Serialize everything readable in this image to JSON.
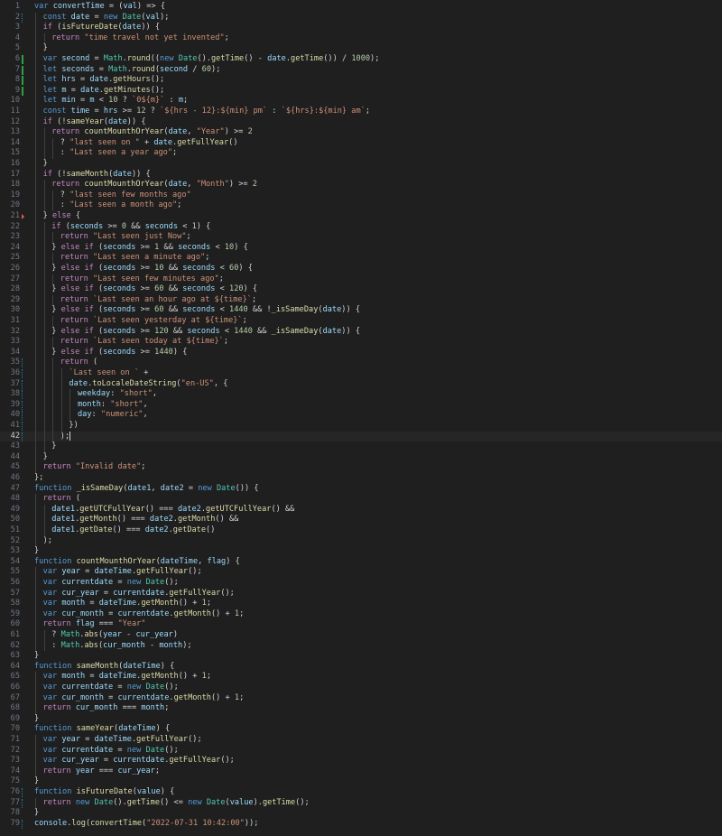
{
  "editor": {
    "active_line": 42,
    "colors": {
      "background": "#1f1f1f",
      "keyword": "#569cd6",
      "control": "#c586c0",
      "function": "#dcdcaa",
      "variable": "#9cdcfe",
      "class": "#4ec9b0",
      "string": "#ce9178",
      "number": "#b5cea8"
    },
    "lines": [
      {
        "n": "1",
        "indent": 0,
        "code": "var convertTime = (val) => {"
      },
      {
        "n": "2",
        "indent": 1,
        "code": "const date = new Date(val);",
        "gutter": "mod"
      },
      {
        "n": "3",
        "indent": 1,
        "code": "if (isFutureDate(date)) {"
      },
      {
        "n": "4",
        "indent": 2,
        "code": "return \"time travel not yet invented\";"
      },
      {
        "n": "5",
        "indent": 1,
        "code": "}"
      },
      {
        "n": "6",
        "indent": 1,
        "code": "var second = Math.round((new Date().getTime() - date.getTime()) / 1000);",
        "gutter": "add"
      },
      {
        "n": "7",
        "indent": 1,
        "code": "let seconds = Math.round(second / 60);",
        "gutter": "add"
      },
      {
        "n": "8",
        "indent": 1,
        "code": "let hrs = date.getHours();",
        "gutter": "add"
      },
      {
        "n": "9",
        "indent": 1,
        "code": "let m = date.getMinutes();",
        "gutter": "add"
      },
      {
        "n": "10",
        "indent": 1,
        "code": "let min = m < 10 ? `0${m}` : m;"
      },
      {
        "n": "11",
        "indent": 1,
        "code": "const time = hrs >= 12 ? `${hrs - 12}:${min} pm` : `${hrs}:${min} am`;"
      },
      {
        "n": "12",
        "indent": 1,
        "code": "if (!sameYear(date)) {"
      },
      {
        "n": "13",
        "indent": 2,
        "code": "return countMounthOrYear(date, \"Year\") >= 2"
      },
      {
        "n": "14",
        "indent": 3,
        "code": "? \"last seen on \" + date.getFullYear()"
      },
      {
        "n": "15",
        "indent": 3,
        "code": ": \"Last seen a year ago\";"
      },
      {
        "n": "16",
        "indent": 1,
        "code": "}"
      },
      {
        "n": "17",
        "indent": 1,
        "code": "if (!sameMonth(date)) {"
      },
      {
        "n": "18",
        "indent": 2,
        "code": "return countMounthOrYear(date, \"Month\") >= 2"
      },
      {
        "n": "19",
        "indent": 3,
        "code": "? \"last seen few months ago\""
      },
      {
        "n": "20",
        "indent": 3,
        "code": ": \"Last seen a month ago\";"
      },
      {
        "n": "21",
        "indent": 1,
        "code": "} else {",
        "gutter": "del"
      },
      {
        "n": "22",
        "indent": 2,
        "code": "if (seconds >= 0 && seconds < 1) {"
      },
      {
        "n": "23",
        "indent": 3,
        "code": "return \"Last seen just Now\";"
      },
      {
        "n": "24",
        "indent": 2,
        "code": "} else if (seconds >= 1 && seconds < 10) {"
      },
      {
        "n": "25",
        "indent": 3,
        "code": "return \"Last seen a minute ago\";"
      },
      {
        "n": "26",
        "indent": 2,
        "code": "} else if (seconds >= 10 && seconds < 60) {"
      },
      {
        "n": "27",
        "indent": 3,
        "code": "return \"Last seen few minutes ago\";"
      },
      {
        "n": "28",
        "indent": 2,
        "code": "} else if (seconds >= 60 && seconds < 120) {"
      },
      {
        "n": "29",
        "indent": 3,
        "code": "return `Last seen an hour ago at ${time}`;"
      },
      {
        "n": "30",
        "indent": 2,
        "code": "} else if (seconds >= 60 && seconds < 1440 && !_isSameDay(date)) {"
      },
      {
        "n": "31",
        "indent": 3,
        "code": "return `Last seen yesterday at ${time}`;"
      },
      {
        "n": "32",
        "indent": 2,
        "code": "} else if (seconds >= 120 && seconds < 1440 && _isSameDay(date)) {"
      },
      {
        "n": "33",
        "indent": 3,
        "code": "return `Last seen today at ${time}`;"
      },
      {
        "n": "34",
        "indent": 2,
        "code": "} else if (seconds >= 1440) {"
      },
      {
        "n": "35",
        "indent": 3,
        "code": "return (",
        "gutter": "mod"
      },
      {
        "n": "36",
        "indent": 4,
        "code": "`Last seen on ` +",
        "gutter": "mod"
      },
      {
        "n": "37",
        "indent": 4,
        "code": "date.toLocaleDateString(\"en-US\", {",
        "gutter": "mod"
      },
      {
        "n": "38",
        "indent": 5,
        "code": "weekday: \"short\",",
        "gutter": "mod"
      },
      {
        "n": "39",
        "indent": 5,
        "code": "month: \"short\",",
        "gutter": "mod"
      },
      {
        "n": "40",
        "indent": 5,
        "code": "day: \"numeric\",",
        "gutter": "mod"
      },
      {
        "n": "41",
        "indent": 4,
        "code": "})",
        "gutter": "mod"
      },
      {
        "n": "42",
        "indent": 3,
        "code": ");",
        "gutter": "mod"
      },
      {
        "n": "43",
        "indent": 2,
        "code": "}"
      },
      {
        "n": "44",
        "indent": 1,
        "code": "}"
      },
      {
        "n": "45",
        "indent": 1,
        "code": "return \"Invalid date\";"
      },
      {
        "n": "46",
        "indent": 0,
        "code": "};"
      },
      {
        "n": "47",
        "indent": 0,
        "code": "function _isSameDay(date1, date2 = new Date()) {"
      },
      {
        "n": "48",
        "indent": 1,
        "code": "return ("
      },
      {
        "n": "49",
        "indent": 2,
        "code": "date1.getUTCFullYear() === date2.getUTCFullYear() &&"
      },
      {
        "n": "50",
        "indent": 2,
        "code": "date1.getMonth() === date2.getMonth() &&"
      },
      {
        "n": "51",
        "indent": 2,
        "code": "date1.getDate() === date2.getDate()"
      },
      {
        "n": "52",
        "indent": 1,
        "code": ");"
      },
      {
        "n": "53",
        "indent": 0,
        "code": "}"
      },
      {
        "n": "54",
        "indent": 0,
        "code": "function countMounthOrYear(dateTime, flag) {"
      },
      {
        "n": "55",
        "indent": 1,
        "code": "var year = dateTime.getFullYear();"
      },
      {
        "n": "56",
        "indent": 1,
        "code": "var currentdate = new Date();"
      },
      {
        "n": "57",
        "indent": 1,
        "code": "var cur_year = currentdate.getFullYear();"
      },
      {
        "n": "58",
        "indent": 1,
        "code": "var month = dateTime.getMonth() + 1;"
      },
      {
        "n": "59",
        "indent": 1,
        "code": "var cur_month = currentdate.getMonth() + 1;"
      },
      {
        "n": "60",
        "indent": 1,
        "code": "return flag === \"Year\""
      },
      {
        "n": "61",
        "indent": 2,
        "code": "? Math.abs(year - cur_year)"
      },
      {
        "n": "62",
        "indent": 2,
        "code": ": Math.abs(cur_month - month);"
      },
      {
        "n": "63",
        "indent": 0,
        "code": "}"
      },
      {
        "n": "64",
        "indent": 0,
        "code": "function sameMonth(dateTime) {"
      },
      {
        "n": "65",
        "indent": 1,
        "code": "var month = dateTime.getMonth() + 1;"
      },
      {
        "n": "66",
        "indent": 1,
        "code": "var currentdate = new Date();"
      },
      {
        "n": "67",
        "indent": 1,
        "code": "var cur_month = currentdate.getMonth() + 1;"
      },
      {
        "n": "68",
        "indent": 1,
        "code": "return cur_month === month;"
      },
      {
        "n": "69",
        "indent": 0,
        "code": "}"
      },
      {
        "n": "70",
        "indent": 0,
        "code": "function sameYear(dateTime) {"
      },
      {
        "n": "71",
        "indent": 1,
        "code": "var year = dateTime.getFullYear();"
      },
      {
        "n": "72",
        "indent": 1,
        "code": "var currentdate = new Date();"
      },
      {
        "n": "73",
        "indent": 1,
        "code": "var cur_year = currentdate.getFullYear();"
      },
      {
        "n": "74",
        "indent": 1,
        "code": "return year === cur_year;"
      },
      {
        "n": "75",
        "indent": 0,
        "code": "}"
      },
      {
        "n": "76",
        "indent": 0,
        "code": "function isFutureDate(value) {",
        "gutter": "mod"
      },
      {
        "n": "77",
        "indent": 1,
        "code": "return new Date().getTime() <= new Date(value).getTime();",
        "gutter": "mod"
      },
      {
        "n": "78",
        "indent": 0,
        "code": "}"
      },
      {
        "n": "79",
        "indent": 0,
        "code": "console.log(convertTime(\"2022-07-31 10:42:00\"));",
        "gutter": "mod"
      }
    ]
  }
}
